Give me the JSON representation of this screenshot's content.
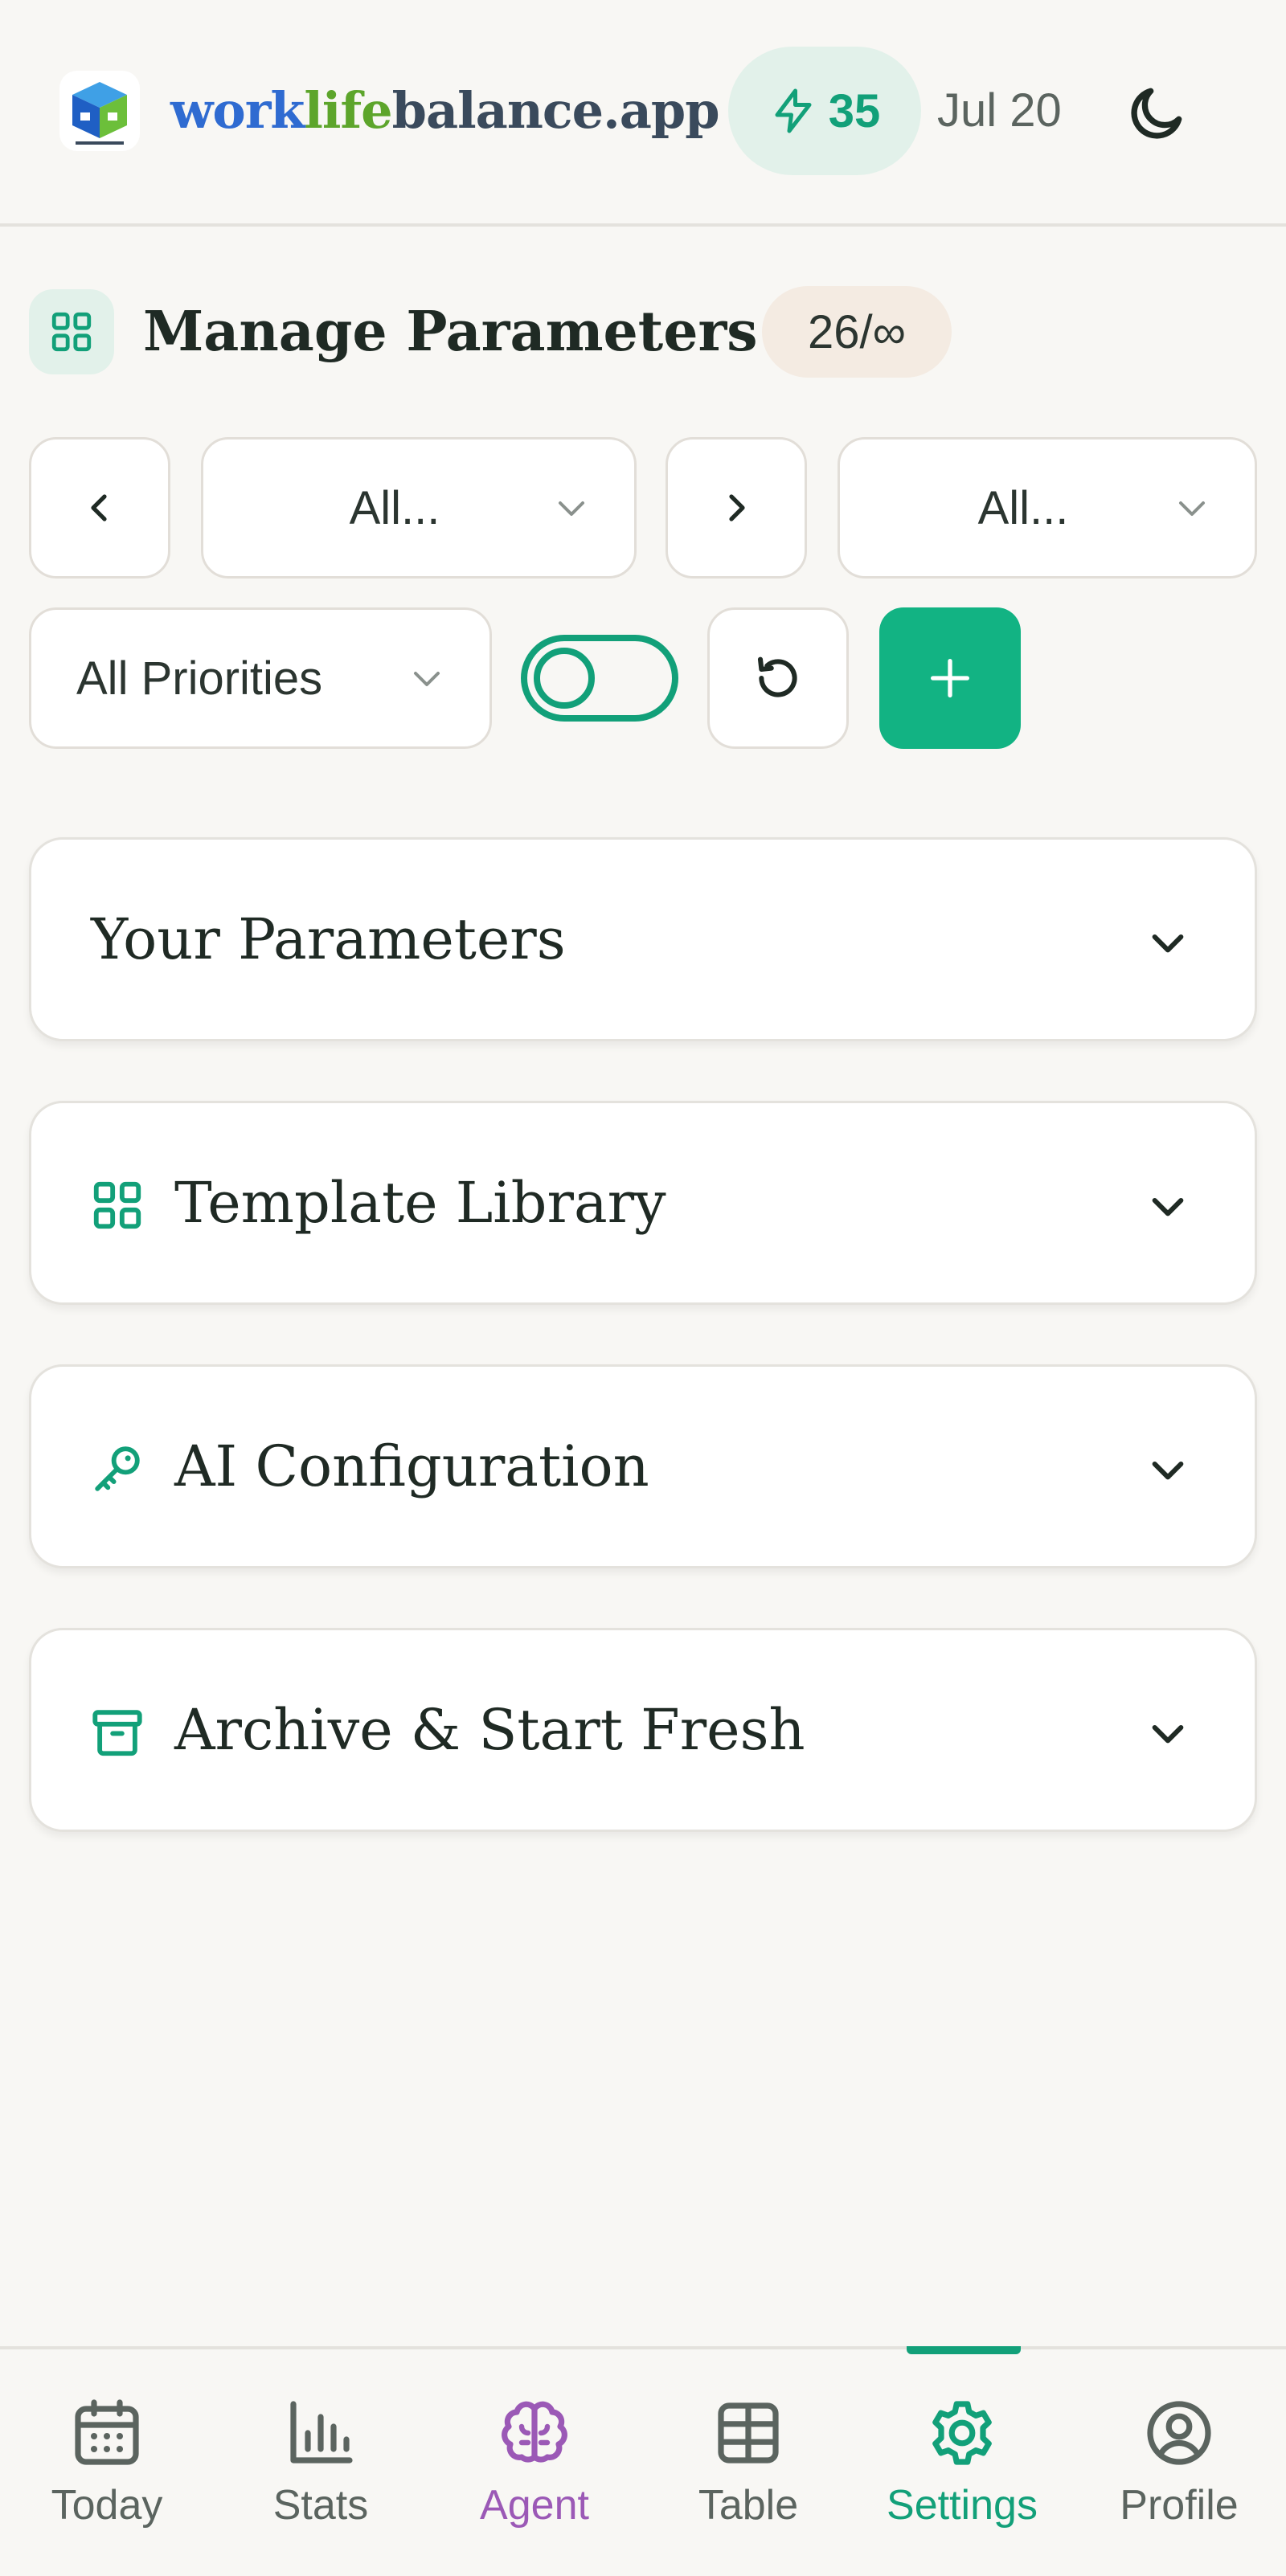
{
  "header": {
    "brand_part1": "work",
    "brand_part2": "life",
    "brand_part3": "balance",
    "brand_part4": ".app",
    "streak_count": "35",
    "date": "Jul 20",
    "icons": {
      "logo": "app-logo",
      "streak": "lightning-icon",
      "theme": "moon-icon"
    }
  },
  "page": {
    "title": "Manage Parameters",
    "count_badge": "26/∞"
  },
  "filters": {
    "category_select": "All...",
    "second_select": "All...",
    "priority_select": "All Priorities",
    "toggle_on": false
  },
  "sections": [
    {
      "label": "Your Parameters",
      "icon": ""
    },
    {
      "label": "Template Library",
      "icon": "grid-icon"
    },
    {
      "label": "AI Configuration",
      "icon": "key-icon"
    },
    {
      "label": "Archive & Start Fresh",
      "icon": "archive-icon"
    }
  ],
  "bottom_nav": [
    {
      "label": "Today",
      "icon": "calendar-icon"
    },
    {
      "label": "Stats",
      "icon": "bar-chart-icon"
    },
    {
      "label": "Agent",
      "icon": "brain-icon"
    },
    {
      "label": "Table",
      "icon": "table-icon"
    },
    {
      "label": "Settings",
      "icon": "gear-icon",
      "active": true
    },
    {
      "label": "Profile",
      "icon": "user-circle-icon"
    }
  ],
  "colors": {
    "accent": "#12a079",
    "accent_button": "#12b383",
    "agent_purple": "#9b59b6",
    "background": "#f8f7f4"
  }
}
